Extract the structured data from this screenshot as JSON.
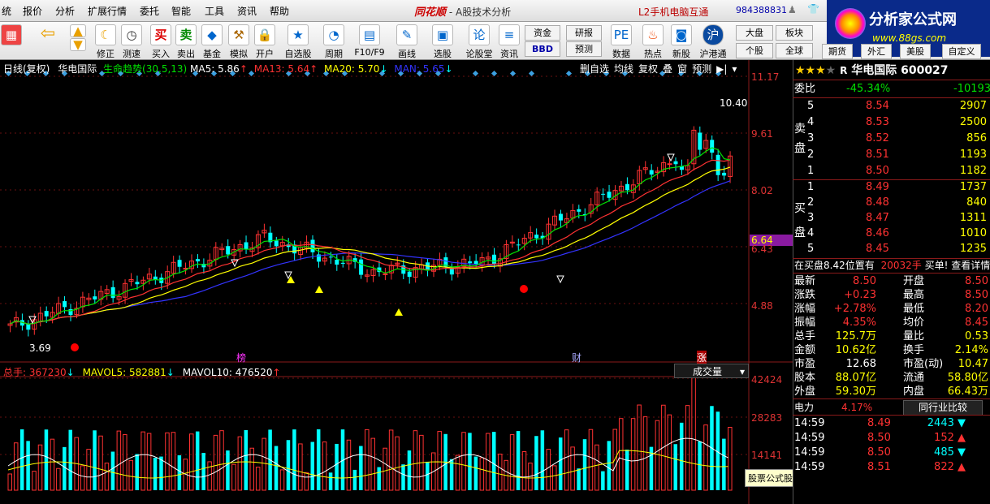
{
  "menu": [
    "统",
    "报价",
    "分析",
    "扩展行情",
    "委托",
    "智能",
    "工具",
    "资讯",
    "帮助"
  ],
  "title": {
    "brand": "同花顺",
    "subtitle": "A股技术分析",
    "l2": "L2手机电脑互通",
    "phone": "984388831"
  },
  "toolbar": {
    "buttons": [
      "修正",
      "测速",
      "买入",
      "卖出",
      "基金",
      "模拟",
      "开户",
      "自选股",
      "周期",
      "F10/F9",
      "画线",
      "选股",
      "论股堂",
      "资讯",
      "数据",
      "热点",
      "新股",
      "沪港通"
    ],
    "small": [
      "资金",
      "研报",
      "BBD",
      "预测",
      "大盘",
      "板块",
      "个股",
      "全球",
      "期货",
      "外汇",
      "美股",
      "自定义"
    ]
  },
  "logo": {
    "title": "分析家公式网",
    "url": "www.88gs.com"
  },
  "indicator_bar": {
    "mode": "日线(复权)",
    "stock": "华电国际",
    "indicator": "生命趋势(30,5,13)",
    "ma5": "MA5: 5.86",
    "ma13": "MA13: 5.64",
    "ma20": "MA20: 5.70",
    "man": "MAN: 5.65",
    "right_buttons": [
      "删自选",
      "均线",
      "复权",
      "叠",
      "窗",
      "预测"
    ]
  },
  "price_axis": [
    "11.17",
    "9.61",
    "8.02",
    "6.64",
    "6.43",
    "4.88"
  ],
  "price_labels": {
    "high": "10.40",
    "low": "3.69"
  },
  "chart_markers": [
    "榜",
    "财",
    "涨"
  ],
  "volume_bar": {
    "total": "总手: 367230",
    "mavol5": "MAVOL5: 582881",
    "mavol10": "MAVOL10: 476520",
    "selector": "成交量",
    "axis": [
      "42424",
      "28283",
      "14141"
    ]
  },
  "watermark": "股票公式股票软件下载[分析家公式网www.88gs.com]",
  "quote": {
    "name": "华电国际",
    "code": "600027",
    "weibi_label": "委比",
    "weibi": "-45.34%",
    "weicha": "-10193",
    "sell_label": "卖盘",
    "buy_label": "买盘",
    "sell": [
      {
        "lvl": "5",
        "price": "8.54",
        "vol": "2907"
      },
      {
        "lvl": "4",
        "price": "8.53",
        "vol": "2500"
      },
      {
        "lvl": "3",
        "price": "8.52",
        "vol": "856"
      },
      {
        "lvl": "2",
        "price": "8.51",
        "vol": "1193"
      },
      {
        "lvl": "1",
        "price": "8.50",
        "vol": "1182"
      }
    ],
    "buy": [
      {
        "lvl": "1",
        "price": "8.49",
        "vol": "1737"
      },
      {
        "lvl": "2",
        "price": "8.48",
        "vol": "840"
      },
      {
        "lvl": "3",
        "price": "8.47",
        "vol": "1311"
      },
      {
        "lvl": "4",
        "price": "8.46",
        "vol": "1010"
      },
      {
        "lvl": "5",
        "price": "8.45",
        "vol": "1235"
      }
    ],
    "notice": "在买盘8.42位置有",
    "notice_vol": "20032手",
    "notice_act": "买单!",
    "notice_link": "查看详情",
    "stats": [
      [
        "最新",
        "8.50",
        "开盘",
        "8.50"
      ],
      [
        "涨跌",
        "+0.23",
        "最高",
        "8.50"
      ],
      [
        "涨幅",
        "+2.78%",
        "最低",
        "8.20"
      ],
      [
        "振幅",
        "4.35%",
        "均价",
        "8.45"
      ],
      [
        "总手",
        "125.7万",
        "量比",
        "0.53"
      ],
      [
        "金额",
        "10.62亿",
        "换手",
        "2.14%"
      ],
      [
        "市盈",
        "12.68",
        "市盈(动)",
        "10.47"
      ],
      [
        "股本",
        "88.07亿",
        "流通",
        "58.80亿"
      ],
      [
        "外盘",
        "59.30万",
        "内盘",
        "66.43万"
      ]
    ],
    "sector": "电力",
    "sector_chg": "4.17%",
    "sector_btn": "同行业比较",
    "ticks": [
      {
        "t": "14:59",
        "p": "8.49",
        "v": "2443",
        "d": "down"
      },
      {
        "t": "14:59",
        "p": "8.50",
        "v": "152",
        "d": "up"
      },
      {
        "t": "14:59",
        "p": "8.50",
        "v": "485",
        "d": "down"
      },
      {
        "t": "14:59",
        "p": "8.51",
        "v": "822",
        "d": "up"
      }
    ]
  },
  "colors": {
    "up": "#ff3232",
    "down": "#00ffff",
    "ma5": "#ffffff",
    "ma13": "#ff3232",
    "ma20": "#ffff00",
    "man": "#3333ff",
    "life": "#00e000"
  }
}
